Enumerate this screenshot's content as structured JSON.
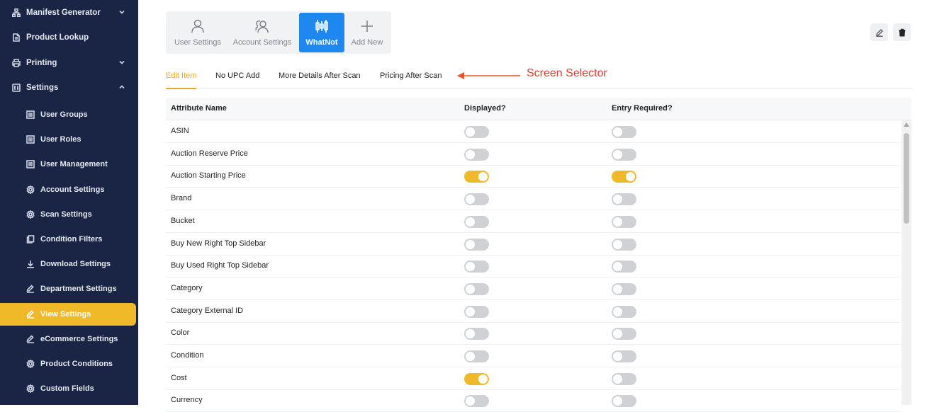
{
  "sidebar": {
    "items": [
      {
        "label": "Manifest Generator",
        "icon": "sitemap-icon",
        "chevron": "down"
      },
      {
        "label": "Product Lookup",
        "icon": "document-icon"
      },
      {
        "label": "Printing",
        "icon": "printer-icon",
        "chevron": "down"
      },
      {
        "label": "Settings",
        "icon": "settings-panel-icon",
        "chevron": "up"
      }
    ],
    "subitems": [
      {
        "label": "User Groups",
        "icon": "list-icon"
      },
      {
        "label": "User Roles",
        "icon": "list-icon"
      },
      {
        "label": "User Management",
        "icon": "list-icon"
      },
      {
        "label": "Account Settings",
        "icon": "gear-icon"
      },
      {
        "label": "Scan Settings",
        "icon": "gear-icon"
      },
      {
        "label": "Condition Filters",
        "icon": "copy-icon"
      },
      {
        "label": "Download Settings",
        "icon": "download-icon"
      },
      {
        "label": "Department Settings",
        "icon": "pencil-icon"
      },
      {
        "label": "View Settings",
        "icon": "pencil-icon",
        "active": true
      },
      {
        "label": "eCommerce Settings",
        "icon": "pencil-icon"
      },
      {
        "label": "Product Conditions",
        "icon": "gear-icon"
      },
      {
        "label": "Custom Fields",
        "icon": "gear-icon"
      }
    ]
  },
  "toolbar": {
    "items": [
      {
        "label": "User Settings",
        "icon": "user-icon"
      },
      {
        "label": "Account Settings",
        "icon": "users-icon"
      },
      {
        "label": "WhatNot",
        "icon": "candlestick-icon",
        "active": true
      },
      {
        "label": "Add New",
        "icon": "plus-icon"
      }
    ]
  },
  "actions": {
    "edit": "edit-icon",
    "delete": "trash-icon"
  },
  "tabs": [
    {
      "label": "Edit Item",
      "active": true
    },
    {
      "label": "No UPC Add"
    },
    {
      "label": "More Details After Scan"
    },
    {
      "label": "Pricing After Scan"
    }
  ],
  "annotation": {
    "text": "Screen Selector",
    "color": "#e23b2b"
  },
  "table": {
    "headers": [
      "Attribute Name",
      "Displayed?",
      "Entry Required?"
    ],
    "rows": [
      {
        "name": "ASIN",
        "displayed": false,
        "required": false
      },
      {
        "name": "Auction Reserve Price",
        "displayed": false,
        "required": false
      },
      {
        "name": "Auction Starting Price",
        "displayed": true,
        "required": true
      },
      {
        "name": "Brand",
        "displayed": false,
        "required": false
      },
      {
        "name": "Bucket",
        "displayed": false,
        "required": false
      },
      {
        "name": "Buy New Right Top Sidebar",
        "displayed": false,
        "required": false
      },
      {
        "name": "Buy Used Right Top Sidebar",
        "displayed": false,
        "required": false
      },
      {
        "name": "Category",
        "displayed": false,
        "required": false
      },
      {
        "name": "Category External ID",
        "displayed": false,
        "required": false
      },
      {
        "name": "Color",
        "displayed": false,
        "required": false
      },
      {
        "name": "Condition",
        "displayed": false,
        "required": false
      },
      {
        "name": "Cost",
        "displayed": true,
        "required": false
      },
      {
        "name": "Currency",
        "displayed": false,
        "required": false
      }
    ]
  },
  "colors": {
    "sidebar": "#1a2444",
    "accent": "#f0b92a",
    "active_tool": "#1e88f0"
  }
}
